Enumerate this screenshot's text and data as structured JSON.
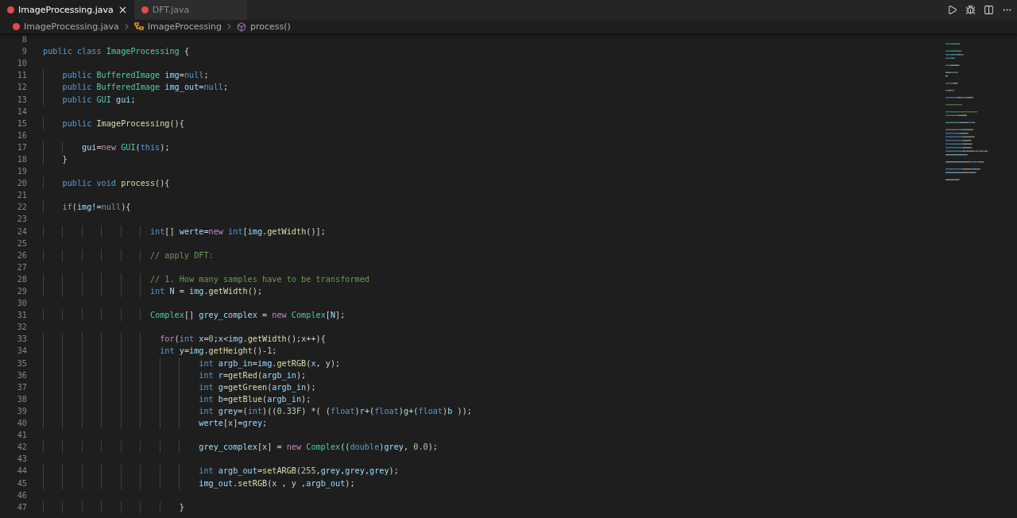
{
  "tabs": [
    {
      "label": "ImageProcessing.java",
      "selected": true
    },
    {
      "label": "DFT.java",
      "selected": false
    }
  ],
  "breadcrumb": [
    {
      "label": "ImageProcessing.java",
      "kind": "file"
    },
    {
      "label": "ImageProcessing",
      "kind": "class"
    },
    {
      "label": "process()",
      "kind": "method"
    }
  ],
  "code_lines": [
    {
      "number": "8"
    },
    {
      "number": "9",
      "tokens": [
        {
          "text": "public ",
          "kind": "keyword"
        },
        {
          "text": "class ",
          "kind": "keyword"
        },
        {
          "text": "ImageProcessing",
          "kind": "type"
        },
        {
          "text": " {",
          "kind": "plain"
        }
      ]
    },
    {
      "number": "10"
    },
    {
      "number": "11",
      "tokens": [
        {
          "text": "    public ",
          "kind": "keyword"
        },
        {
          "text": "BufferedImage ",
          "kind": "type"
        },
        {
          "text": "img",
          "kind": "variable"
        },
        {
          "text": "=",
          "kind": "plain"
        },
        {
          "text": "null",
          "kind": "keyword"
        },
        {
          "text": ";",
          "kind": "plain"
        }
      ]
    },
    {
      "number": "12",
      "tokens": [
        {
          "text": "    public ",
          "kind": "keyword"
        },
        {
          "text": "BufferedImage ",
          "kind": "type"
        },
        {
          "text": "img_out",
          "kind": "variable"
        },
        {
          "text": "=",
          "kind": "plain"
        },
        {
          "text": "null",
          "kind": "keyword"
        },
        {
          "text": ";",
          "kind": "plain"
        }
      ]
    },
    {
      "number": "13",
      "tokens": [
        {
          "text": "    public ",
          "kind": "keyword"
        },
        {
          "text": "GUI ",
          "kind": "type"
        },
        {
          "text": "gui",
          "kind": "variable"
        },
        {
          "text": ";",
          "kind": "plain"
        }
      ]
    },
    {
      "number": "14"
    },
    {
      "number": "15",
      "tokens": [
        {
          "text": "    public ",
          "kind": "keyword"
        },
        {
          "text": "ImageProcessing",
          "kind": "function"
        },
        {
          "text": "(){",
          "kind": "plain"
        }
      ]
    },
    {
      "number": "16"
    },
    {
      "number": "17",
      "tokens": [
        {
          "text": "        gui",
          "kind": "variable"
        },
        {
          "text": "=",
          "kind": "plain"
        },
        {
          "text": "new ",
          "kind": "control"
        },
        {
          "text": "GUI",
          "kind": "type"
        },
        {
          "text": "(",
          "kind": "plain"
        },
        {
          "text": "this",
          "kind": "keyword"
        },
        {
          "text": ");",
          "kind": "plain"
        }
      ]
    },
    {
      "number": "18",
      "tokens": [
        {
          "text": "    }",
          "kind": "plain"
        }
      ]
    },
    {
      "number": "19"
    },
    {
      "number": "20",
      "tokens": [
        {
          "text": "    public ",
          "kind": "keyword"
        },
        {
          "text": "void ",
          "kind": "keyword"
        },
        {
          "text": "process",
          "kind": "function"
        },
        {
          "text": "(){",
          "kind": "plain"
        }
      ]
    },
    {
      "number": "21"
    },
    {
      "number": "22",
      "tokens": [
        {
          "text": "    if",
          "kind": "control"
        },
        {
          "text": "(",
          "kind": "plain"
        },
        {
          "text": "img",
          "kind": "variable"
        },
        {
          "text": "!=",
          "kind": "plain"
        },
        {
          "text": "null",
          "kind": "keyword"
        },
        {
          "text": "){",
          "kind": "plain"
        }
      ]
    },
    {
      "number": "23"
    },
    {
      "number": "24",
      "tokens": [
        {
          "text": "                      int",
          "kind": "keyword"
        },
        {
          "text": "[] ",
          "kind": "plain"
        },
        {
          "text": "werte",
          "kind": "variable"
        },
        {
          "text": "=",
          "kind": "plain"
        },
        {
          "text": "new ",
          "kind": "control"
        },
        {
          "text": "int",
          "kind": "keyword"
        },
        {
          "text": "[",
          "kind": "plain"
        },
        {
          "text": "img",
          "kind": "variable"
        },
        {
          "text": ".",
          "kind": "plain"
        },
        {
          "text": "getWidth",
          "kind": "function"
        },
        {
          "text": "()];",
          "kind": "plain"
        }
      ]
    },
    {
      "number": "25"
    },
    {
      "number": "26",
      "tokens": [
        {
          "text": "                      // apply DFT:",
          "kind": "comment"
        }
      ]
    },
    {
      "number": "27"
    },
    {
      "number": "28",
      "tokens": [
        {
          "text": "                      // 1. How many samples have to be transformed",
          "kind": "comment"
        }
      ]
    },
    {
      "number": "29",
      "tokens": [
        {
          "text": "                      int ",
          "kind": "keyword"
        },
        {
          "text": "N",
          "kind": "variable"
        },
        {
          "text": " = ",
          "kind": "plain"
        },
        {
          "text": "img",
          "kind": "variable"
        },
        {
          "text": ".",
          "kind": "plain"
        },
        {
          "text": "getWidth",
          "kind": "function"
        },
        {
          "text": "();",
          "kind": "plain"
        }
      ]
    },
    {
      "number": "30"
    },
    {
      "number": "31",
      "tokens": [
        {
          "text": "                      Complex",
          "kind": "type"
        },
        {
          "text": "[] ",
          "kind": "plain"
        },
        {
          "text": "grey_complex",
          "kind": "variable"
        },
        {
          "text": " = ",
          "kind": "plain"
        },
        {
          "text": "new ",
          "kind": "control"
        },
        {
          "text": "Complex",
          "kind": "type"
        },
        {
          "text": "[",
          "kind": "plain"
        },
        {
          "text": "N",
          "kind": "variable"
        },
        {
          "text": "];",
          "kind": "plain"
        }
      ]
    },
    {
      "number": "32"
    },
    {
      "number": "33",
      "tokens": [
        {
          "text": "                        for",
          "kind": "control"
        },
        {
          "text": "(",
          "kind": "plain"
        },
        {
          "text": "int ",
          "kind": "keyword"
        },
        {
          "text": "x",
          "kind": "variable"
        },
        {
          "text": "=",
          "kind": "plain"
        },
        {
          "text": "0",
          "kind": "number"
        },
        {
          "text": ";",
          "kind": "plain"
        },
        {
          "text": "x",
          "kind": "variable"
        },
        {
          "text": "<",
          "kind": "plain"
        },
        {
          "text": "img",
          "kind": "variable"
        },
        {
          "text": ".",
          "kind": "plain"
        },
        {
          "text": "getWidth",
          "kind": "function"
        },
        {
          "text": "();",
          "kind": "plain"
        },
        {
          "text": "x",
          "kind": "variable"
        },
        {
          "text": "++){",
          "kind": "plain"
        }
      ]
    },
    {
      "number": "34",
      "tokens": [
        {
          "text": "                        int ",
          "kind": "keyword"
        },
        {
          "text": "y",
          "kind": "variable"
        },
        {
          "text": "=",
          "kind": "plain"
        },
        {
          "text": "img",
          "kind": "variable"
        },
        {
          "text": ".",
          "kind": "plain"
        },
        {
          "text": "getHeight",
          "kind": "function"
        },
        {
          "text": "()-",
          "kind": "plain"
        },
        {
          "text": "1",
          "kind": "number"
        },
        {
          "text": ";",
          "kind": "plain"
        }
      ]
    },
    {
      "number": "35",
      "tokens": [
        {
          "text": "                                int ",
          "kind": "keyword"
        },
        {
          "text": "argb_in",
          "kind": "variable"
        },
        {
          "text": "=",
          "kind": "plain"
        },
        {
          "text": "img",
          "kind": "variable"
        },
        {
          "text": ".",
          "kind": "plain"
        },
        {
          "text": "getRGB",
          "kind": "function"
        },
        {
          "text": "(",
          "kind": "plain"
        },
        {
          "text": "x",
          "kind": "variable"
        },
        {
          "text": ", ",
          "kind": "plain"
        },
        {
          "text": "y",
          "kind": "variable"
        },
        {
          "text": ");",
          "kind": "plain"
        }
      ]
    },
    {
      "number": "36",
      "tokens": [
        {
          "text": "                                int ",
          "kind": "keyword"
        },
        {
          "text": "r",
          "kind": "variable"
        },
        {
          "text": "=",
          "kind": "plain"
        },
        {
          "text": "getRed",
          "kind": "function"
        },
        {
          "text": "(",
          "kind": "plain"
        },
        {
          "text": "argb_in",
          "kind": "variable"
        },
        {
          "text": ");",
          "kind": "plain"
        }
      ]
    },
    {
      "number": "37",
      "tokens": [
        {
          "text": "                                int ",
          "kind": "keyword"
        },
        {
          "text": "g",
          "kind": "variable"
        },
        {
          "text": "=",
          "kind": "plain"
        },
        {
          "text": "getGreen",
          "kind": "function"
        },
        {
          "text": "(",
          "kind": "plain"
        },
        {
          "text": "argb_in",
          "kind": "variable"
        },
        {
          "text": ");",
          "kind": "plain"
        }
      ]
    },
    {
      "number": "38",
      "tokens": [
        {
          "text": "                                int ",
          "kind": "keyword"
        },
        {
          "text": "b",
          "kind": "variable"
        },
        {
          "text": "=",
          "kind": "plain"
        },
        {
          "text": "getBlue",
          "kind": "function"
        },
        {
          "text": "(",
          "kind": "plain"
        },
        {
          "text": "argb_in",
          "kind": "variable"
        },
        {
          "text": ");",
          "kind": "plain"
        }
      ]
    },
    {
      "number": "39",
      "tokens": [
        {
          "text": "                                int ",
          "kind": "keyword"
        },
        {
          "text": "grey",
          "kind": "variable"
        },
        {
          "text": "=(",
          "kind": "plain"
        },
        {
          "text": "int",
          "kind": "keyword"
        },
        {
          "text": ")((",
          "kind": "plain"
        },
        {
          "text": "0.33F",
          "kind": "number"
        },
        {
          "text": ") *( (",
          "kind": "plain"
        },
        {
          "text": "float",
          "kind": "keyword"
        },
        {
          "text": ")",
          "kind": "plain"
        },
        {
          "text": "r",
          "kind": "variable"
        },
        {
          "text": "+(",
          "kind": "plain"
        },
        {
          "text": "float",
          "kind": "keyword"
        },
        {
          "text": ")",
          "kind": "plain"
        },
        {
          "text": "g",
          "kind": "variable"
        },
        {
          "text": "+(",
          "kind": "plain"
        },
        {
          "text": "float",
          "kind": "keyword"
        },
        {
          "text": ")",
          "kind": "plain"
        },
        {
          "text": "b",
          "kind": "variable"
        },
        {
          "text": " ));",
          "kind": "plain"
        }
      ]
    },
    {
      "number": "40",
      "tokens": [
        {
          "text": "                                werte",
          "kind": "variable"
        },
        {
          "text": "[",
          "kind": "plain"
        },
        {
          "text": "x",
          "kind": "variable"
        },
        {
          "text": "]=",
          "kind": "plain"
        },
        {
          "text": "grey",
          "kind": "variable"
        },
        {
          "text": ";",
          "kind": "plain"
        }
      ]
    },
    {
      "number": "41"
    },
    {
      "number": "42",
      "tokens": [
        {
          "text": "                                grey_complex",
          "kind": "variable"
        },
        {
          "text": "[",
          "kind": "plain"
        },
        {
          "text": "x",
          "kind": "variable"
        },
        {
          "text": "] = ",
          "kind": "plain"
        },
        {
          "text": "new ",
          "kind": "control"
        },
        {
          "text": "Complex",
          "kind": "type"
        },
        {
          "text": "((",
          "kind": "plain"
        },
        {
          "text": "double",
          "kind": "keyword"
        },
        {
          "text": ")",
          "kind": "plain"
        },
        {
          "text": "grey",
          "kind": "variable"
        },
        {
          "text": ", ",
          "kind": "plain"
        },
        {
          "text": "0.0",
          "kind": "number"
        },
        {
          "text": ");",
          "kind": "plain"
        }
      ]
    },
    {
      "number": "43"
    },
    {
      "number": "44",
      "tokens": [
        {
          "text": "                                int ",
          "kind": "keyword"
        },
        {
          "text": "argb_out",
          "kind": "variable"
        },
        {
          "text": "=",
          "kind": "plain"
        },
        {
          "text": "setARGB",
          "kind": "function"
        },
        {
          "text": "(",
          "kind": "plain"
        },
        {
          "text": "255",
          "kind": "number"
        },
        {
          "text": ",",
          "kind": "plain"
        },
        {
          "text": "grey",
          "kind": "variable"
        },
        {
          "text": ",",
          "kind": "plain"
        },
        {
          "text": "grey",
          "kind": "variable"
        },
        {
          "text": ",",
          "kind": "plain"
        },
        {
          "text": "grey",
          "kind": "variable"
        },
        {
          "text": ");",
          "kind": "plain"
        }
      ]
    },
    {
      "number": "45",
      "tokens": [
        {
          "text": "                                img_out",
          "kind": "variable"
        },
        {
          "text": ".",
          "kind": "plain"
        },
        {
          "text": "setRGB",
          "kind": "function"
        },
        {
          "text": "(",
          "kind": "plain"
        },
        {
          "text": "x",
          "kind": "variable"
        },
        {
          "text": " , ",
          "kind": "plain"
        },
        {
          "text": "y",
          "kind": "variable"
        },
        {
          "text": " ,",
          "kind": "plain"
        },
        {
          "text": "argb_out",
          "kind": "variable"
        },
        {
          "text": ");",
          "kind": "plain"
        }
      ]
    },
    {
      "number": "46"
    },
    {
      "number": "47",
      "tokens": [
        {
          "text": "                            }",
          "kind": "plain"
        }
      ]
    }
  ]
}
